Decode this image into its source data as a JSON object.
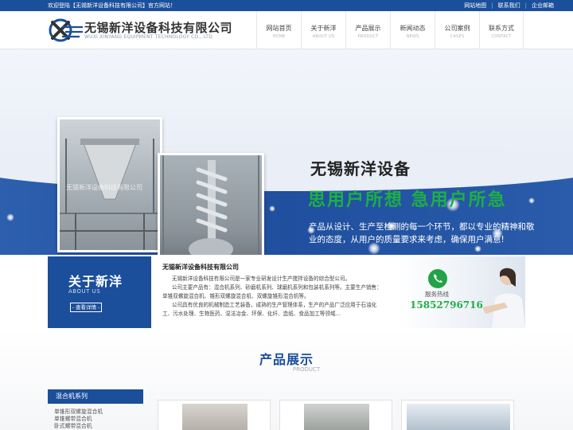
{
  "topbar": {
    "welcome": "欢迎登陆【无锡新洋设备科技有限公司】官方网站！",
    "links": [
      "网站地图",
      "联系我们",
      "企业邮箱"
    ]
  },
  "header": {
    "company_name": "无锡新洋设备科技有限公司",
    "company_en": "WUXI XINYANG EQUIPMENT TECHNOLOGY CO., LTD.",
    "nav": [
      {
        "cn": "网站首页",
        "en": "HOME"
      },
      {
        "cn": "关于新洋",
        "en": "ABOUT US"
      },
      {
        "cn": "产品展示",
        "en": "PRODUCT"
      },
      {
        "cn": "新闻动态",
        "en": "NEWS"
      },
      {
        "cn": "公司案例",
        "en": "CASES"
      },
      {
        "cn": "联系方式",
        "en": "CONTACT"
      }
    ]
  },
  "banner": {
    "title": "无锡新洋设备",
    "slogan": "思用户所想 急用户所急",
    "description": "产品从设计、生产至检测的每一个环节，都以专业的精神和敬业的态度，从用户的质量要求来考虑，确保用户满意!",
    "photo_watermark": "无锡新洋设备科技有限公司"
  },
  "about": {
    "title": "关于新洋",
    "en": "ABOUT US",
    "more": "- 查看详情 -",
    "heading": "无锡新洋设备科技有限公司",
    "paragraphs": [
      "无锡新洋设备科技有限公司是一家专业研发设计生产搅拌设备的综合型公司。",
      "公司主要产品有：混合机系列、砂磨机系列、球磨机系列和包装机系列等。主要生产销售：单锥双螺旋混合机、锥形双螺旋混合机、双螺旋锥形混合机等。",
      "公司具有优良的机械制造工艺装备，成熟的生产管理体系，生产的产品广泛应用于石油化工、污水处理、生物医药、湿法冶金、环保、化纤、造纸、食品加工等领域..."
    ],
    "hotline_label": "服务热线",
    "hotline_number": "15852796716"
  },
  "products": {
    "title": "产品展示",
    "en": "PRODUCT",
    "category": "混合机系列",
    "items": [
      "单锥形双螺旋混合机",
      "单锥螺带混合机",
      "卧式螺带混合机"
    ]
  },
  "colors": {
    "brand_blue": "#1b4e9b",
    "accent_green": "#1fae45"
  }
}
